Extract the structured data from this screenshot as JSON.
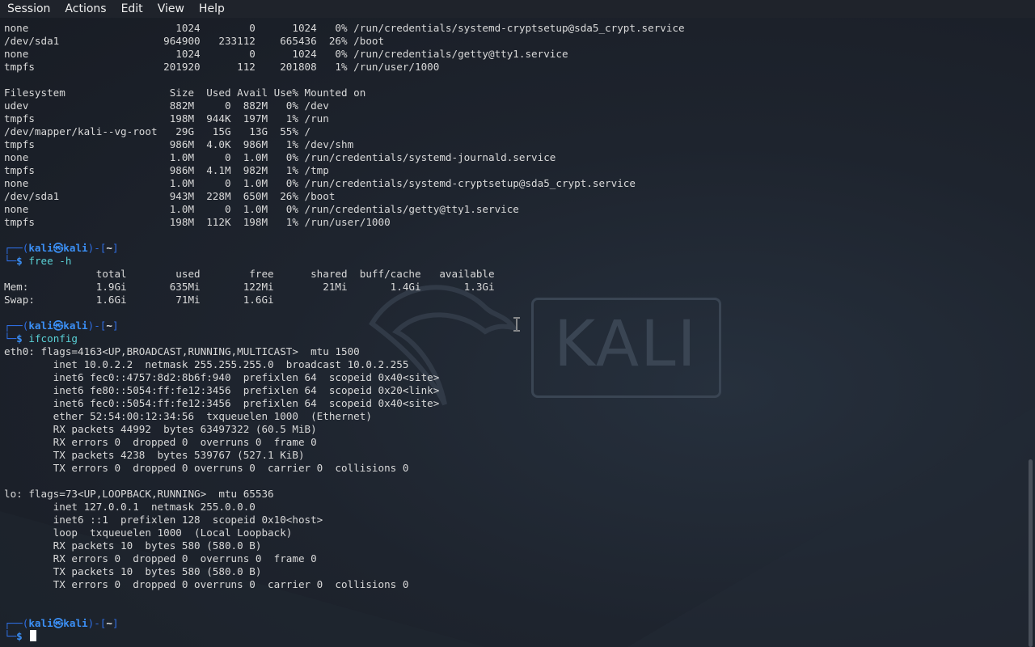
{
  "menubar": {
    "items": [
      "Session",
      "Actions",
      "Edit",
      "View",
      "Help"
    ]
  },
  "background": {
    "logo_text": "KALI"
  },
  "terminal": {
    "lines": [
      {
        "t": "none                        1024        0      1024   0% /run/credentials/systemd-cryptsetup@sda5_crypt.service"
      },
      {
        "t": "/dev/sda1                 964900   233112    665436  26% /boot"
      },
      {
        "t": "none                        1024        0      1024   0% /run/credentials/getty@tty1.service"
      },
      {
        "t": "tmpfs                     201920      112    201808   1% /run/user/1000"
      },
      {
        "t": ""
      },
      {
        "t": "Filesystem                 Size  Used Avail Use% Mounted on"
      },
      {
        "t": "udev                       882M     0  882M   0% /dev"
      },
      {
        "t": "tmpfs                      198M  944K  197M   1% /run"
      },
      {
        "t": "/dev/mapper/kali--vg-root   29G   15G   13G  55% /"
      },
      {
        "t": "tmpfs                      986M  4.0K  986M   1% /dev/shm"
      },
      {
        "t": "none                       1.0M     0  1.0M   0% /run/credentials/systemd-journald.service"
      },
      {
        "t": "tmpfs                      986M  4.1M  982M   1% /tmp"
      },
      {
        "t": "none                       1.0M     0  1.0M   0% /run/credentials/systemd-cryptsetup@sda5_crypt.service"
      },
      {
        "t": "/dev/sda1                  943M  228M  650M  26% /boot"
      },
      {
        "t": "none                       1.0M     0  1.0M   0% /run/credentials/getty@tty1.service"
      },
      {
        "t": "tmpfs                      198M  112K  198M   1% /run/user/1000"
      },
      {
        "t": ""
      },
      {
        "prompt": true,
        "part": "top"
      },
      {
        "prompt": true,
        "part": "cmd",
        "cmd": "free -h"
      },
      {
        "t": "               total        used        free      shared  buff/cache   available"
      },
      {
        "t": "Mem:           1.9Gi       635Mi       122Mi        21Mi       1.4Gi       1.3Gi"
      },
      {
        "t": "Swap:          1.6Gi        71Mi       1.6Gi"
      },
      {
        "t": ""
      },
      {
        "prompt": true,
        "part": "top"
      },
      {
        "prompt": true,
        "part": "cmd",
        "cmd": "ifconfig"
      },
      {
        "t": "eth0: flags=4163<UP,BROADCAST,RUNNING,MULTICAST>  mtu 1500"
      },
      {
        "t": "        inet 10.0.2.2  netmask 255.255.255.0  broadcast 10.0.2.255"
      },
      {
        "t": "        inet6 fec0::4757:8d2:8b6f:940  prefixlen 64  scopeid 0x40<site>"
      },
      {
        "t": "        inet6 fe80::5054:ff:fe12:3456  prefixlen 64  scopeid 0x20<link>"
      },
      {
        "t": "        inet6 fec0::5054:ff:fe12:3456  prefixlen 64  scopeid 0x40<site>"
      },
      {
        "t": "        ether 52:54:00:12:34:56  txqueuelen 1000  (Ethernet)"
      },
      {
        "t": "        RX packets 44992  bytes 63497322 (60.5 MiB)"
      },
      {
        "t": "        RX errors 0  dropped 0  overruns 0  frame 0"
      },
      {
        "t": "        TX packets 4238  bytes 539767 (527.1 KiB)"
      },
      {
        "t": "        TX errors 0  dropped 0 overruns 0  carrier 0  collisions 0"
      },
      {
        "t": ""
      },
      {
        "t": "lo: flags=73<UP,LOOPBACK,RUNNING>  mtu 65536"
      },
      {
        "t": "        inet 127.0.0.1  netmask 255.0.0.0"
      },
      {
        "t": "        inet6 ::1  prefixlen 128  scopeid 0x10<host>"
      },
      {
        "t": "        loop  txqueuelen 1000  (Local Loopback)"
      },
      {
        "t": "        RX packets 10  bytes 580 (580.0 B)"
      },
      {
        "t": "        RX errors 0  dropped 0  overruns 0  frame 0"
      },
      {
        "t": "        TX packets 10  bytes 580 (580.0 B)"
      },
      {
        "t": "        TX errors 0  dropped 0 overruns 0  carrier 0  collisions 0"
      },
      {
        "t": ""
      },
      {
        "t": ""
      },
      {
        "prompt": true,
        "part": "top"
      },
      {
        "prompt": true,
        "part": "cmd",
        "cmd": "",
        "cursor": true
      }
    ],
    "prompt": {
      "top_left": "┌──(",
      "user": "kali",
      "at": "㉿",
      "host": "kali",
      "mid": ")-[",
      "dir": "~",
      "end": "]",
      "bottom_left": "└─",
      "symbol": "$"
    }
  },
  "colors": {
    "prompt_frame": "#2f6fe4",
    "prompt_user": "#3b8ff5",
    "command": "#5ad1d6",
    "text": "#d9d9d9",
    "background": "#1b2029"
  }
}
